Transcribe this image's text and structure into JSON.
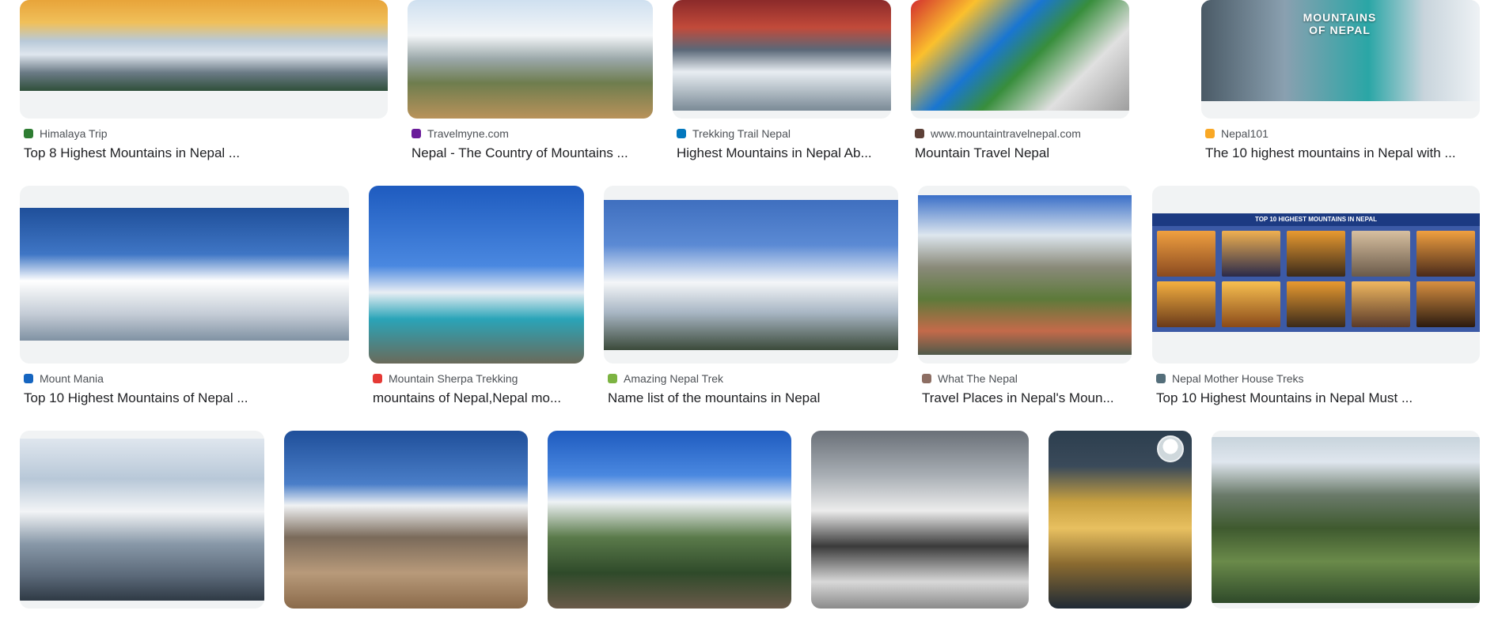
{
  "rows": [
    [
      {
        "source": "Himalaya Trip",
        "title": "Top 8 Highest Mountains in Nepal ...",
        "favicon_color": "#2e7d32"
      },
      {
        "source": "Travelmyne.com",
        "title": "Nepal - The Country of Mountains ...",
        "favicon_color": "#6a1b9a"
      },
      {
        "source": "Trekking Trail Nepal",
        "title": "Highest Mountains in Nepal Ab...",
        "favicon_color": "#0277bd"
      },
      {
        "source": "www.mountaintravelnepal.com",
        "title": "Mountain Travel Nepal",
        "favicon_color": "#5d4037"
      },
      {
        "source": "Nepal101",
        "title": "The 10 highest mountains in Nepal with ...",
        "favicon_color": "#f9a825"
      }
    ],
    [
      {
        "source": "Mount Mania",
        "title": "Top 10 Highest Mountains of Nepal ...",
        "favicon_color": "#1565c0"
      },
      {
        "source": "Mountain Sherpa Trekking",
        "title": "mountains of Nepal,Nepal mo...",
        "favicon_color": "#e53935"
      },
      {
        "source": "Amazing Nepal Trek",
        "title": "Name list of the mountains in Nepal",
        "favicon_color": "#7cb342"
      },
      {
        "source": "What The Nepal",
        "title": "Travel Places in Nepal's Moun...",
        "favicon_color": "#8d6e63"
      },
      {
        "source": "Nepal Mother House Treks",
        "title": "Top 10 Highest Mountains in Nepal Must ...",
        "favicon_color": "#546e7a"
      }
    ]
  ],
  "poster": {
    "text": "MOUNTAINS OF NEPAL"
  },
  "chart_header": {
    "text": "TOP 10 HIGHEST MOUNTAINS IN NEPAL"
  }
}
